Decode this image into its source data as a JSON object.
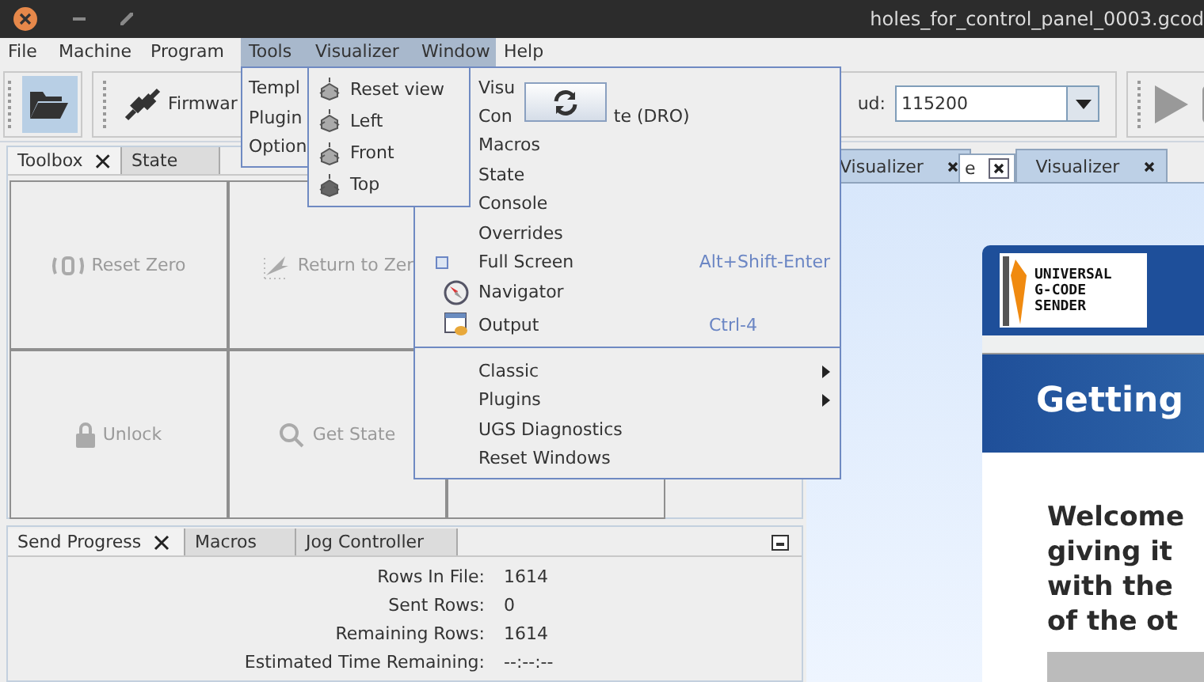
{
  "window": {
    "title": "holes_for_control_panel_0003.gcod"
  },
  "menu_bar": [
    {
      "label": "File",
      "selected": false
    },
    {
      "label": "Machine",
      "selected": false
    },
    {
      "label": "Program",
      "selected": false
    },
    {
      "label": "Tools",
      "selected": true
    },
    {
      "label": "Visualizer",
      "selected": true
    },
    {
      "label": "Window",
      "selected": true
    },
    {
      "label": "Help",
      "selected": false
    }
  ],
  "toolbar": {
    "open_selected": true,
    "firmware_label": "Firmwar",
    "baud_label": "ud:",
    "baud_value": "115200"
  },
  "left_tabs": [
    {
      "label": "Toolbox",
      "selected": true
    },
    {
      "label": "State",
      "selected": false
    }
  ],
  "toolbox": [
    [
      {
        "kind": "reset",
        "label": "Reset Zero"
      },
      {
        "kind": "return",
        "label": "Return to Zer"
      }
    ],
    [
      {
        "kind": "unlock",
        "label": "Unlock"
      },
      {
        "kind": "state",
        "label": "Get State"
      },
      {
        "kind": "empty"
      }
    ]
  ],
  "bottom_tabs": [
    {
      "label": "Send Progress",
      "selected": true
    },
    {
      "label": "Macros",
      "selected": false
    },
    {
      "label": "Jog Controller",
      "selected": false
    }
  ],
  "send_progress": [
    {
      "label": "Rows In File:",
      "value": "1614"
    },
    {
      "label": "Sent Rows:",
      "value": "0"
    },
    {
      "label": "Remaining Rows:",
      "value": "1614"
    },
    {
      "label": "Estimated Time Remaining:",
      "value": "--:--:--"
    }
  ],
  "right_tabs": [
    {
      "label": "Visualizer",
      "selected": true
    },
    {
      "label": "e",
      "selected": false
    },
    {
      "label": "Visualizer",
      "selected": true
    }
  ],
  "welcome": {
    "logo": [
      "UNIVERSAL",
      "G-CODE",
      "SENDER"
    ],
    "heading": "Getting",
    "lines": [
      "Welcome",
      "giving it",
      "with the",
      "of the ot"
    ]
  },
  "tools_menu": [
    {
      "label": "Templ"
    },
    {
      "label": "Plugin"
    },
    {
      "label": "Option"
    }
  ],
  "visualizer_menu": [
    {
      "label": "Reset view"
    },
    {
      "label": "Left"
    },
    {
      "label": "Front"
    },
    {
      "label": "Top"
    }
  ],
  "window_menu": [
    {
      "kind": "item",
      "label": "Visu"
    },
    {
      "kind": "split",
      "label": "Con",
      "tail": "te (DRO)"
    },
    {
      "kind": "item",
      "label": "Macros"
    },
    {
      "kind": "item",
      "label": "State"
    },
    {
      "kind": "item",
      "label": "Console"
    },
    {
      "kind": "item",
      "label": "Overrides"
    },
    {
      "kind": "check",
      "label": "Full Screen",
      "checked": false,
      "shortcut": "Alt+Shift-Enter"
    },
    {
      "kind": "navigator",
      "label": "Navigator"
    },
    {
      "kind": "output",
      "label": "Output",
      "shortcut": "Ctrl-4"
    },
    {
      "kind": "separator"
    },
    {
      "kind": "submenu",
      "label": "Classic"
    },
    {
      "kind": "submenu",
      "label": "Plugins"
    },
    {
      "kind": "item",
      "label": "UGS Diagnostics"
    },
    {
      "kind": "item",
      "label": "Reset Windows"
    }
  ]
}
